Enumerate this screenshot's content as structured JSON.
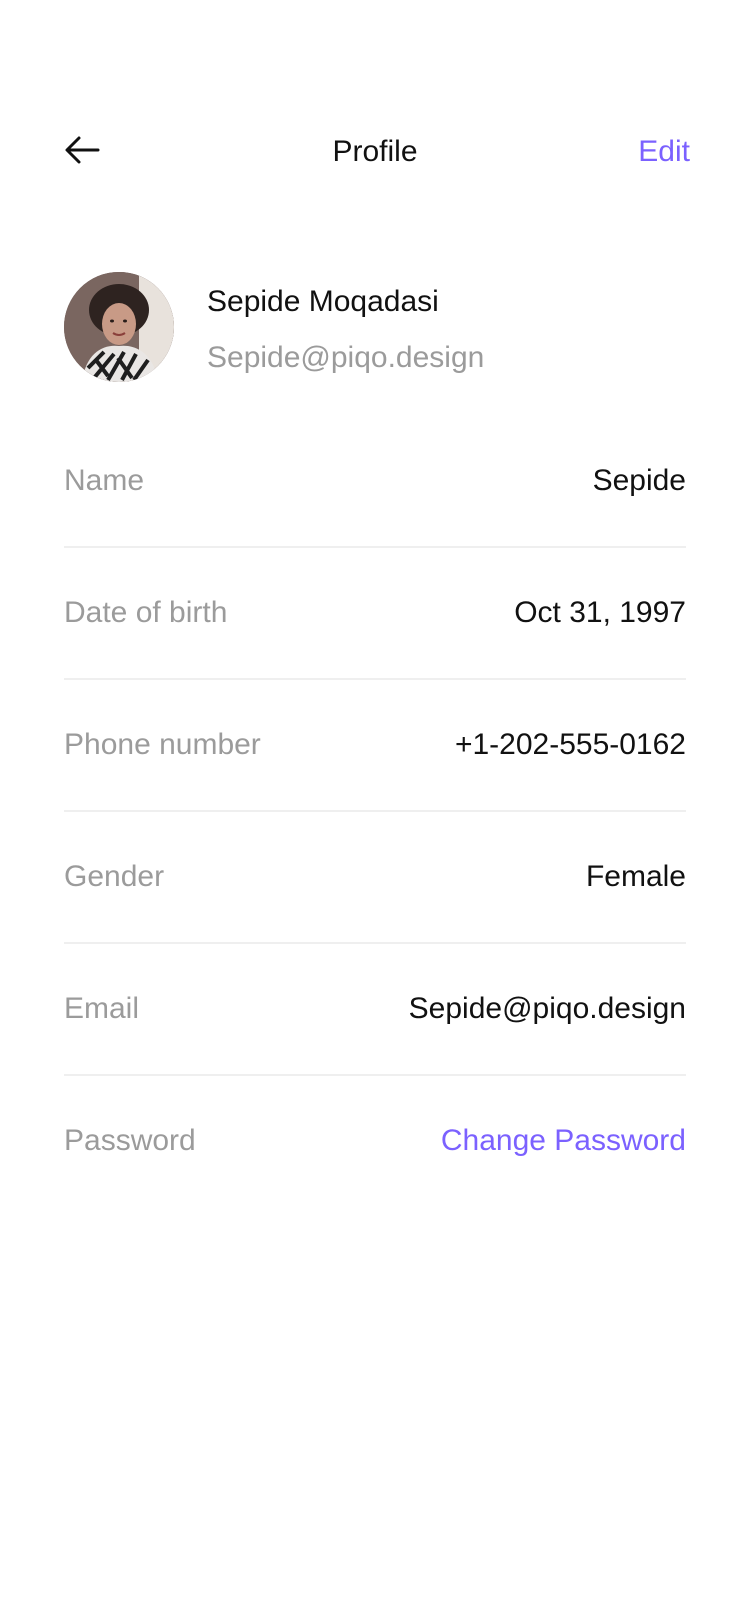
{
  "header": {
    "title": "Profile",
    "edit_label": "Edit",
    "back_icon": "arrow-left-icon"
  },
  "profile": {
    "name": "Sepide Moqadasi",
    "email": "Sepide@piqo.design"
  },
  "fields": [
    {
      "label": "Name",
      "value": "Sepide"
    },
    {
      "label": "Date of birth",
      "value": "Oct 31, 1997"
    },
    {
      "label": "Phone number",
      "value": "+1-202-555-0162"
    },
    {
      "label": "Gender",
      "value": "Female"
    },
    {
      "label": "Email",
      "value": "Sepide@piqo.design"
    },
    {
      "label": "Password",
      "value": "Change Password"
    }
  ],
  "colors": {
    "accent": "#7B61FF",
    "label": "#9B9B9B",
    "text": "#111111",
    "divider": "#EFEFEF"
  }
}
